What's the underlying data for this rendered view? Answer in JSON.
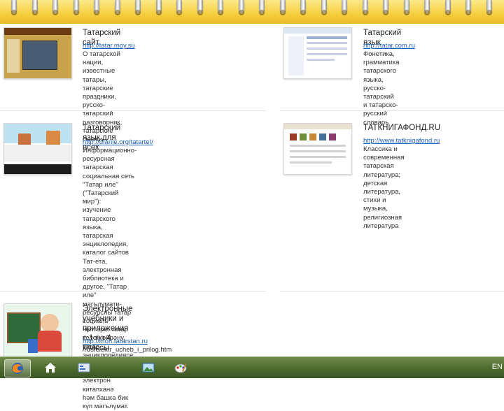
{
  "cards": [
    {
      "title": "Татарский сайт",
      "link": "http://tatar.moy.su",
      "desc": "О татарской нации, известные\nтатары, татарские праздники,\nрусско-татарский разговорник,\nтатарские сказки"
    },
    {
      "title": "Татарский язык",
      "link": "http://tatar.com.ru",
      "desc": "Фонетика, грамматика\nтатарского языка, русско-\nтатарский и татарско-русский\nсловарь"
    },
    {
      "title": "Татарский язык для всех",
      "link": "http://ufarile.org/tatarteI/",
      "desc": "Информационно-ресурсная\nтатарская социальная сеть\n\"Татар иле\" (\"Татарский мир\"):\nизучение татарского языка,\nтатарская энциклопедия,\nкаталог сайтов Тат-ета,\nэлектронная библиотека и\nдругое. \"Татар иле\" мәгълүмати-\nресурслы татар социаль\nчелтәре: татар телен өйрәну,\nтатар энциклопедиясе, Татнет\nкаталогы, электрон китапханә\nһәм башка бик күп мәгълүмат."
    },
    {
      "title": "ТАТКНИГАФОНД.RU",
      "link": "http://www.tatknigafond.ru",
      "desc": "Классика и современная\nтатарская литература; детская\nлитература, стихи и музыка,\nрелигиозная литература"
    },
    {
      "title": "Электронные учебники и\nприложения с 1 по 4\nклассы",
      "link": "http://mon.tatarstan.ru",
      "desc": "/rus/elektr_ucheb_i_prilog.htm"
    }
  ],
  "taskbar": {
    "items": [
      "firefox-icon",
      "home-icon",
      "control-panel-icon",
      "image-viewer-icon",
      "paint-icon"
    ],
    "tray_text": "EN"
  },
  "colors": {
    "spiral": "#f5cf3e",
    "link": "#1a5fb4",
    "taskbar": "#4d6a2e"
  }
}
